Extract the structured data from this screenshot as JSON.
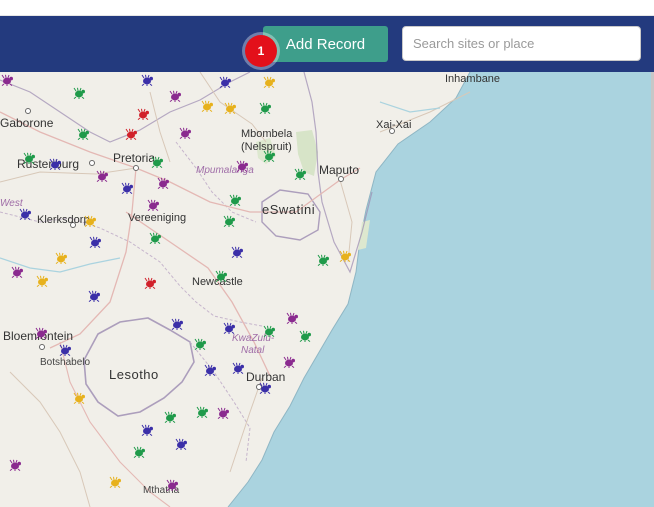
{
  "header": {
    "add_record_label": "Add Record",
    "notification_count": "1",
    "search_placeholder": "Search sites or place"
  },
  "colors": {
    "navbar": "#233a7e",
    "add_button": "#3e9e8b",
    "badge": "#e3101a",
    "sea": "#aad3df",
    "land": "#f1efe9",
    "marker_purple": "#8a2a8f",
    "marker_green": "#1f9a4a",
    "marker_yellow": "#e7b11c",
    "marker_blue": "#3b2fa8",
    "marker_red": "#d1202a"
  },
  "map": {
    "labels": {
      "inhambane": "Inhambane",
      "gaborone": "Gaborone",
      "xai_xai": "Xai-Xai",
      "mbombela": "Mbombela",
      "nelspruit": "(Nelspruit)",
      "rustenburg": "Rustenburg",
      "pretoria": "Pretoria",
      "maputo": "Maputo",
      "mpumalanga": "Mpumalanga",
      "west": "West",
      "klerksdorp": "Klerksdorp",
      "eswatini": "eSwatini",
      "vereeniging": "Vereeniging",
      "newcastle": "Newcastle",
      "bloemfontein": "Bloemfontein",
      "kwazulu": "KwaZulu-",
      "natal": "Natal",
      "botshabelo": "Botshabelo",
      "lesotho": "Lesotho",
      "durban": "Durban",
      "mthatha": "Mthatha"
    },
    "marker_icon": "insect-icon"
  }
}
